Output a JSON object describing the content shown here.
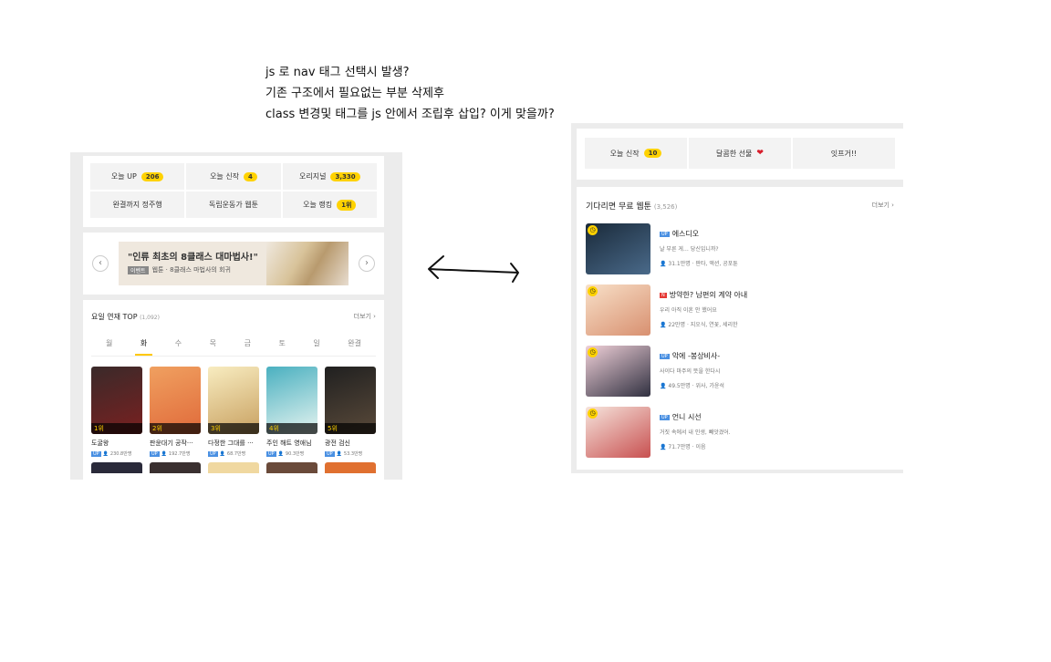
{
  "notes": [
    "js 로 nav 태그 선택시 발생?",
    "기존 구조에서 필요없는 부분 삭제후",
    "class 변경및 태그를 js 안에서 조립후 삽입? 이게 맞을까?"
  ],
  "left": {
    "nav": [
      {
        "label": "오늘 UP",
        "badge": "206"
      },
      {
        "label": "오늘 신작",
        "badge": "4"
      },
      {
        "label": "오리지널",
        "badge": "3,330"
      },
      {
        "label": "완결까지 정주행",
        "badge": ""
      },
      {
        "label": "독립운동가 웹툰",
        "badge": ""
      },
      {
        "label": "오늘 랭킹",
        "badge": "1위"
      }
    ],
    "banner": {
      "prev": "‹",
      "next": "›",
      "title": "\"인류 최초의 8클래스 대마법사!\"",
      "event": "이벤트",
      "sub": "웹툰 · 8클래스 마법사의 회귀"
    },
    "top": {
      "title": "요일 연재 TOP",
      "count": "(1,092)",
      "more": "더보기 ›",
      "days": [
        "월",
        "화",
        "수",
        "목",
        "금",
        "토",
        "일",
        "완결"
      ],
      "selected_day": "화",
      "comics": [
        {
          "rank": "1위",
          "title": "도굴왕",
          "views": "230.8만명",
          "color1": "#3a2a2a",
          "color2": "#7a2020"
        },
        {
          "rank": "2위",
          "title": "판윤대기 공작···",
          "views": "192.7만명",
          "color1": "#f0a060",
          "color2": "#e06a3a"
        },
        {
          "rank": "3위",
          "title": "다정한 그대를 ···",
          "views": "68.7만명",
          "color1": "#f8ecc0",
          "color2": "#c8a060"
        },
        {
          "rank": "4위",
          "title": "주인 해트 영애님",
          "views": "90.3만명",
          "color1": "#4ab0c0",
          "color2": "#e6f4f0"
        },
        {
          "rank": "5위",
          "title": "광전 검신",
          "views": "53.3만명",
          "color1": "#202020",
          "color2": "#5a4a3a"
        }
      ]
    }
  },
  "right": {
    "nav": [
      {
        "label": "오늘 신작",
        "badge": "10"
      },
      {
        "label": "달콤한 선물",
        "badge": ""
      },
      {
        "label": "잇프거!!",
        "badge": ""
      }
    ],
    "heart_icon": "❤",
    "free": {
      "title": "기다리면 무료 웹툰",
      "count": "(3,526)",
      "more": "더보기 ›",
      "items": [
        {
          "tag": "UP",
          "name": "에스디오",
          "desc": "날 부른 게… 당신입니까?",
          "meta": "31.1만명 · 판타, 액션, 공포툰",
          "color1": "#1a2a3a",
          "color2": "#4a6a8a"
        },
        {
          "tag": "N",
          "name": "방약한? 남편의 계약 아내",
          "desc": "우리 아직 이혼 안 했어요",
          "meta": "22만명 · 지오식, 연꽃, 세리한",
          "color1": "#f8e0c8",
          "color2": "#d89070"
        },
        {
          "tag": "UP",
          "name": "악에 -봉상비사-",
          "desc": "사이다 마주의 뜻을 한다시",
          "meta": "49.5만명 · 위사, 가윤석",
          "color1": "#f0d0d8",
          "color2": "#303040"
        },
        {
          "tag": "UP",
          "name": "언니 시선",
          "desc": "거짓 속에서 내 인생, 빼앗겼어.",
          "meta": "71.7만명 · 이음",
          "color1": "#f6e4dc",
          "color2": "#c85050"
        }
      ]
    }
  }
}
